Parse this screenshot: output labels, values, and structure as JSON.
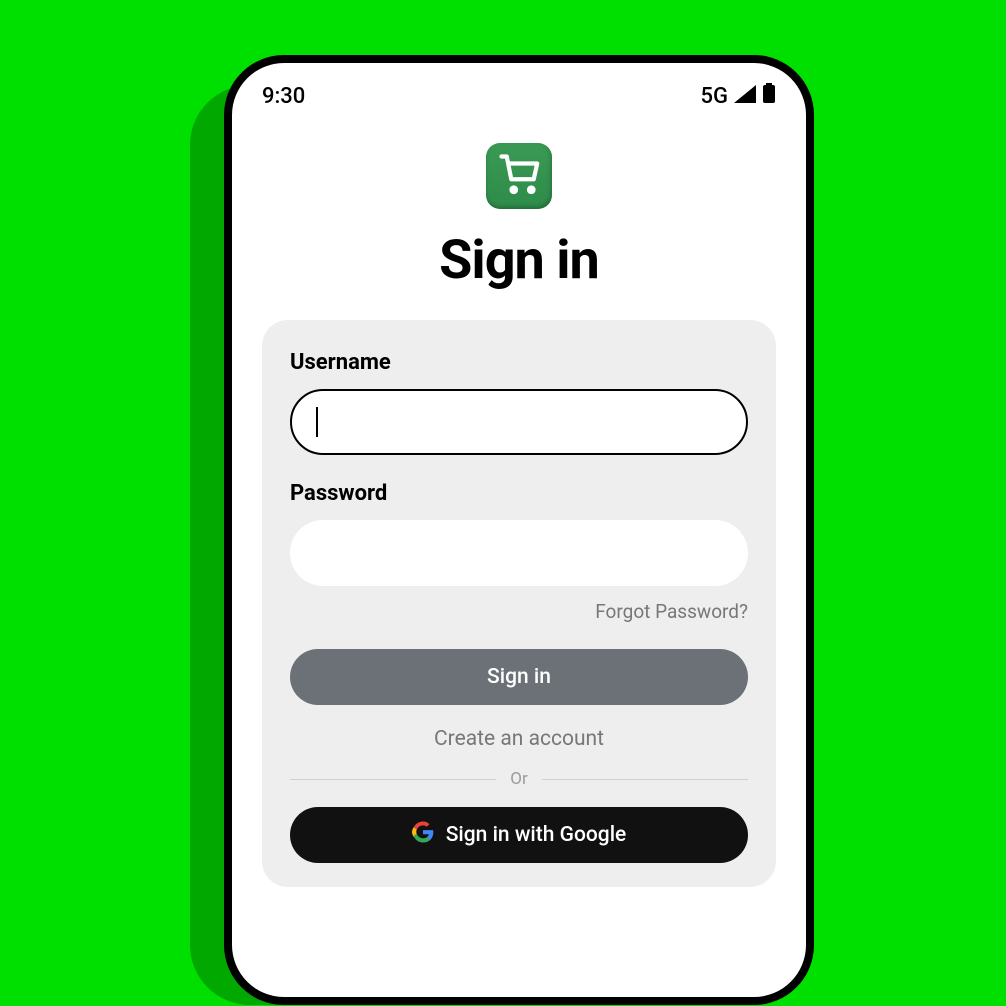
{
  "status": {
    "time": "9:30",
    "network": "5G"
  },
  "page": {
    "title": "Sign in"
  },
  "form": {
    "username_label": "Username",
    "username_value": "",
    "password_label": "Password",
    "password_value": "",
    "forgot_link": "Forgot Password?",
    "signin_label": "Sign in",
    "create_label": "Create an account",
    "divider": "Or",
    "google_label": "Sign in with Google"
  },
  "colors": {
    "app_green": "#2e8b4a",
    "button_gray": "#6b7176",
    "background_gray": "#eeeeee"
  },
  "icons": {
    "app": "shopping-cart-icon",
    "signal": "cellular-icon",
    "battery": "battery-icon",
    "google": "google-logo-icon"
  }
}
